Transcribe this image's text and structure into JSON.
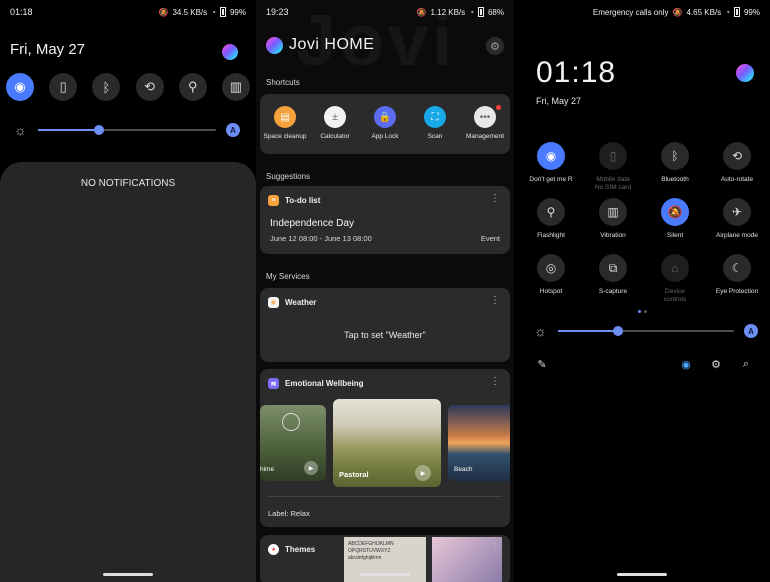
{
  "panel1": {
    "status": {
      "time": "01:18",
      "net_speed": "34.5 KB/s",
      "battery": "99%"
    },
    "date": "Fri, May 27",
    "quick_toggles": [
      {
        "name": "wifi-toggle",
        "icon": "wifi-icon",
        "glyph": "◉",
        "on": true
      },
      {
        "name": "mobile-data-toggle",
        "icon": "no-sim-icon",
        "glyph": "▯",
        "on": false
      },
      {
        "name": "bluetooth-toggle",
        "icon": "bluetooth-icon",
        "glyph": "ᛒ",
        "on": false
      },
      {
        "name": "auto-rotate-toggle",
        "icon": "rotate-icon",
        "glyph": "⟲",
        "on": false
      },
      {
        "name": "flashlight-toggle",
        "icon": "flashlight-icon",
        "glyph": "⚲",
        "on": false
      },
      {
        "name": "vibration-toggle",
        "icon": "vibrate-icon",
        "glyph": "▥",
        "on": false
      }
    ],
    "brightness": {
      "level": 0.34,
      "auto_label": "A"
    },
    "empty_message": "NO NOTIFICATIONS"
  },
  "panel2": {
    "status": {
      "time": "19:23",
      "net_speed": "1.12 KB/s",
      "battery": "68%"
    },
    "background_word": "Jovi",
    "header_title": "Jovi HOME",
    "shortcuts_label": "Shortcuts",
    "shortcuts": [
      {
        "label": "Space cleanup",
        "icon": "broom-icon",
        "glyph": "▤",
        "color": "#f5a23c",
        "badge": false
      },
      {
        "label": "Calculator",
        "icon": "calculator-icon",
        "glyph": "±",
        "color": "#f2f2f2",
        "badge": false
      },
      {
        "label": "App Lock",
        "icon": "lock-icon",
        "glyph": "🔒",
        "color": "#5b6cf0",
        "badge": false
      },
      {
        "label": "Scan",
        "icon": "scan-icon",
        "glyph": "⛶",
        "color": "#1aa9e8",
        "badge": false
      },
      {
        "label": "Management",
        "icon": "more-icon",
        "glyph": "•••",
        "color": "#e8e8e8",
        "badge": true
      }
    ],
    "suggestions_label": "Suggestions",
    "todo": {
      "title": "To-do list",
      "event_title": "Independence Day",
      "event_dates": "June 12 08:00 - June 13 08:00",
      "event_type": "Event"
    },
    "services_label": "My Services",
    "weather": {
      "title": "Weather",
      "prompt": "Tap to set \"Weather\""
    },
    "emotional": {
      "title": "Emotional Wellbeing",
      "items": [
        {
          "label": "hime"
        },
        {
          "label": "Pastoral"
        },
        {
          "label": "Beach"
        }
      ],
      "footer_label": "Label: Relax"
    },
    "themes": {
      "title": "Themes",
      "sample_text": "ABCDEFGHIJKLMN OPQRSTUVWXYZ abcdefghijklmn"
    }
  },
  "panel3": {
    "status": {
      "carrier_text": "Emergency calls only",
      "net_speed": "4.65 KB/s",
      "battery": "99%"
    },
    "clock": "01:18",
    "date": "Fri, May 27",
    "tiles": [
      {
        "label": "Don't get me R",
        "icon": "wifi-icon",
        "glyph": "◉",
        "state": "on"
      },
      {
        "label": "Mobile data\nNo SIM card",
        "icon": "no-sim-icon",
        "glyph": "▯",
        "state": "dim"
      },
      {
        "label": "Bluetooth",
        "icon": "bluetooth-icon",
        "glyph": "ᛒ",
        "state": "off"
      },
      {
        "label": "Auto-rotate",
        "icon": "rotate-icon",
        "glyph": "⟲",
        "state": "off"
      },
      {
        "label": "Flashlight",
        "icon": "flashlight-icon",
        "glyph": "⚲",
        "state": "off"
      },
      {
        "label": "Vibration",
        "icon": "vibrate-icon",
        "glyph": "▥",
        "state": "off"
      },
      {
        "label": "Silent",
        "icon": "bell-off-icon",
        "glyph": "🔕",
        "state": "on"
      },
      {
        "label": "Airplane mode",
        "icon": "airplane-icon",
        "glyph": "✈",
        "state": "off"
      },
      {
        "label": "Hotspot",
        "icon": "hotspot-icon",
        "glyph": "◎",
        "state": "off"
      },
      {
        "label": "S-capture",
        "icon": "crop-icon",
        "glyph": "⧉",
        "state": "off"
      },
      {
        "label": "Device\ncontrols",
        "icon": "home-icon",
        "glyph": "⌂",
        "state": "dim"
      },
      {
        "label": "Eye Protection",
        "icon": "moon-icon",
        "glyph": "☾",
        "state": "off"
      }
    ],
    "brightness": {
      "level": 0.34,
      "auto_label": "A"
    },
    "tools": [
      {
        "name": "edit-icon",
        "glyph": "✎",
        "color": "#dddddd"
      },
      {
        "name": "account-icon",
        "glyph": "◉",
        "color": "#4fa8ff"
      },
      {
        "name": "gear-icon",
        "glyph": "⚙",
        "color": "#dddddd"
      },
      {
        "name": "search-icon",
        "glyph": "⌕",
        "color": "#dddddd"
      }
    ]
  }
}
